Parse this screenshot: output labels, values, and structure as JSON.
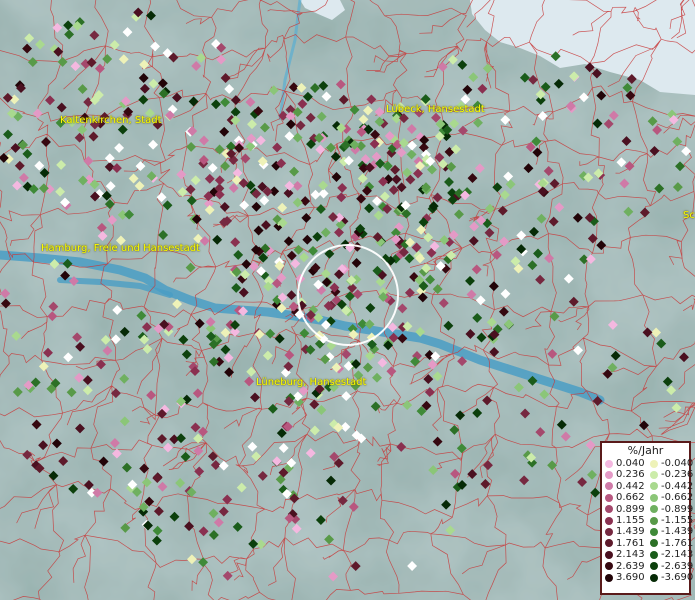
{
  "map": {
    "cities": [
      {
        "name": "Kaltenkirchen, Stadt"
      },
      {
        "name": "Lübeck, Hansestadt"
      },
      {
        "name": "Hamburg, Freie und Hansestadt"
      },
      {
        "name": "Lüneburg, Hansestadt"
      },
      {
        "name": "Sc"
      }
    ]
  },
  "legend": {
    "title": "%/Jahr",
    "positive_colors": [
      "#f4b8e0",
      "#e49ac6",
      "#cf7aa7",
      "#b8577f",
      "#a4486c",
      "#8a3050",
      "#762840",
      "#5e1a2b",
      "#4a1020",
      "#360810",
      "#220408"
    ],
    "negative_colors": [
      "#eef2b8",
      "#ccecaa",
      "#a9d98f",
      "#8bc678",
      "#6fb060",
      "#589a48",
      "#3f8a38",
      "#2c7026",
      "#1a5c1a",
      "#0c400c",
      "#062a06"
    ],
    "rows": [
      {
        "pos": "0.040",
        "neg": "-0.040"
      },
      {
        "pos": "0.236",
        "neg": "-0.236"
      },
      {
        "pos": "0.442",
        "neg": "-0.442"
      },
      {
        "pos": "0.662",
        "neg": "-0.662"
      },
      {
        "pos": "0.899",
        "neg": "-0.899"
      },
      {
        "pos": "1.155",
        "neg": "-1.155"
      },
      {
        "pos": "1.439",
        "neg": "-1.439"
      },
      {
        "pos": "1.761",
        "neg": "-1.761"
      },
      {
        "pos": "2.143",
        "neg": "-2.143"
      },
      {
        "pos": "2.639",
        "neg": "-2.639"
      },
      {
        "pos": "3.690",
        "neg": "-3.690"
      }
    ]
  }
}
